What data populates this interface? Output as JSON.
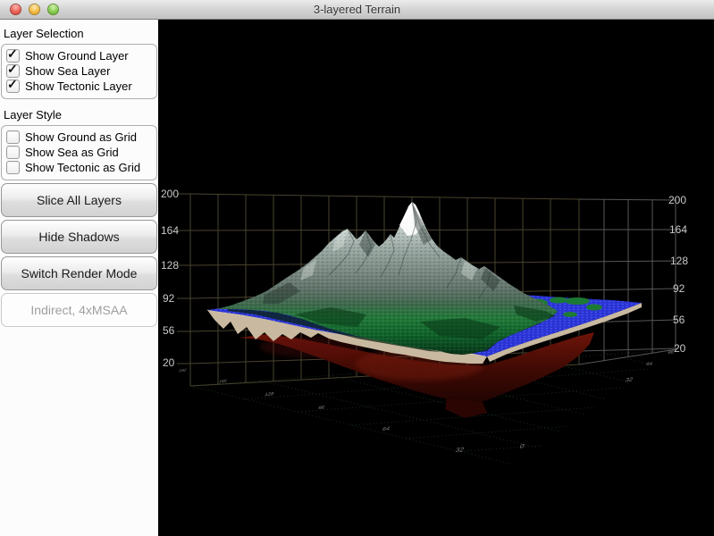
{
  "window": {
    "title": "3-layered Terrain"
  },
  "sidebar": {
    "selection": {
      "heading": "Layer Selection",
      "items": [
        {
          "label": "Show Ground Layer",
          "checked": true,
          "mark": "✓"
        },
        {
          "label": "Show Sea Layer",
          "checked": true,
          "mark": "✓"
        },
        {
          "label": "Show Tectonic Layer",
          "checked": true,
          "mark": "✓"
        }
      ]
    },
    "style": {
      "heading": "Layer Style",
      "items": [
        {
          "label": "Show Ground as Grid",
          "checked": false,
          "mark": ""
        },
        {
          "label": "Show Sea as Grid",
          "checked": false,
          "mark": ""
        },
        {
          "label": "Show Tectonic as Grid",
          "checked": false,
          "mark": ""
        }
      ]
    },
    "buttons": [
      {
        "label": "Slice All Layers"
      },
      {
        "label": "Hide Shadows"
      },
      {
        "label": "Switch Render Mode"
      }
    ],
    "render_mode_status": "Indirect, 4xMSAA"
  },
  "plot": {
    "background": "#000000",
    "left_ticks": [
      "200",
      "164",
      "128",
      "92",
      "56",
      "20"
    ],
    "right_ticks": [
      "200",
      "164",
      "128",
      "92",
      "56",
      "20"
    ],
    "floor_ticks_left": [
      "192",
      "160",
      "128",
      "96",
      "64",
      "32"
    ],
    "floor_ticks_right": [
      "0",
      "32",
      "64",
      "96"
    ],
    "colors": {
      "sea": "#2c36d8",
      "ground_sand": "#c9b9a0",
      "terrain_green": "#1c7a35",
      "snow": "#ffffff",
      "tectonic_red": "#6e1409",
      "wall_grid_olive": "#4d4731",
      "wall_grid_gray": "#616161",
      "floor_grid_green": "#2c4c2c",
      "tick_text": "#c9c9c9"
    }
  }
}
